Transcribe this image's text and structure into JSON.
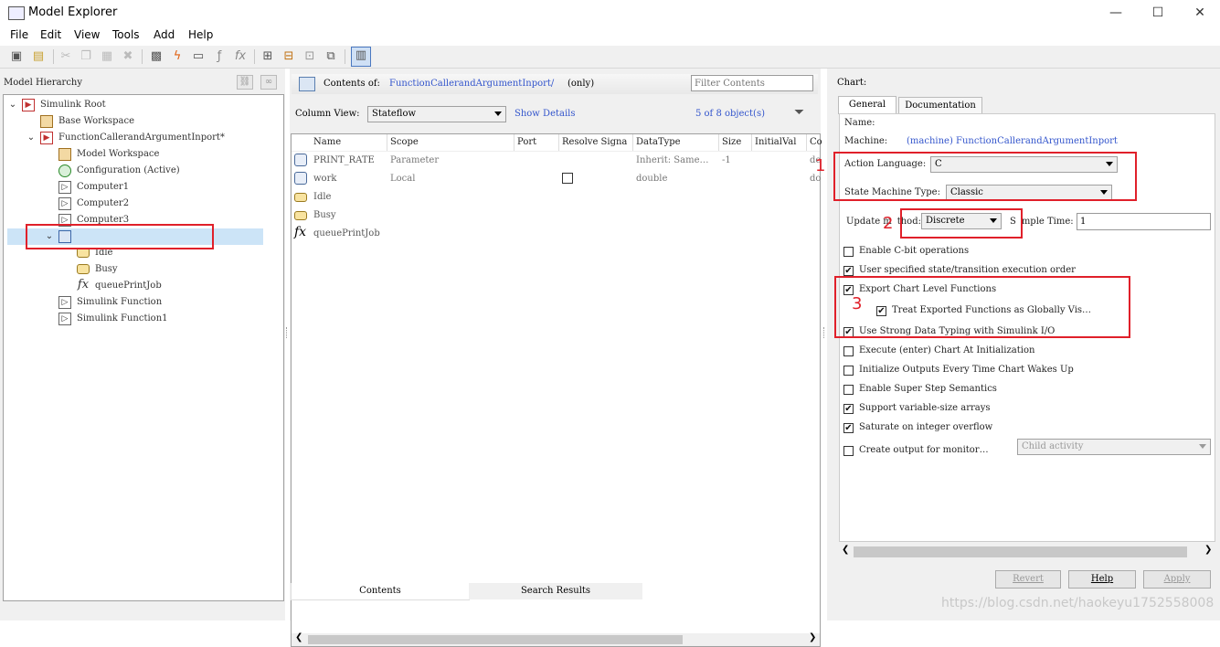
{
  "window": {
    "title": "Model Explorer",
    "min": "—",
    "max": "☐",
    "close": "✕"
  },
  "menu": [
    "File",
    "Edit",
    "View",
    "Tools",
    "Add",
    "Help"
  ],
  "left": {
    "header": "Model Hierarchy",
    "tree": [
      {
        "label": "Simulink Root",
        "indent": 0,
        "expander": "⌄",
        "icon": "simulink-root-icon"
      },
      {
        "label": "Base Workspace",
        "indent": 1,
        "expander": "",
        "icon": "workspace-icon"
      },
      {
        "label": "FunctionCallerandArgumentInport*",
        "indent": 1,
        "expander": "⌄",
        "icon": "model-icon"
      },
      {
        "label": "Model Workspace",
        "indent": 2,
        "expander": "",
        "icon": "workspace-icon"
      },
      {
        "label": "Configuration (Active)",
        "indent": 2,
        "expander": "",
        "icon": "config-gear-icon"
      },
      {
        "label": "Computer1",
        "indent": 2,
        "expander": "",
        "icon": "subsystem-icon"
      },
      {
        "label": "Computer2",
        "indent": 2,
        "expander": "",
        "icon": "subsystem-icon"
      },
      {
        "label": "Computer3",
        "indent": 2,
        "expander": "",
        "icon": "subsystem-icon"
      },
      {
        "label": "",
        "indent": 2,
        "expander": "⌄",
        "icon": "chart-icon",
        "selected": true
      },
      {
        "label": "Idle",
        "indent": 3,
        "expander": "",
        "icon": "state-icon"
      },
      {
        "label": "Busy",
        "indent": 3,
        "expander": "",
        "icon": "state-icon"
      },
      {
        "label": "queuePrintJob",
        "indent": 3,
        "expander": "",
        "icon": "function-icon"
      },
      {
        "label": "Simulink Function",
        "indent": 2,
        "expander": "",
        "icon": "subsystem-icon"
      },
      {
        "label": "Simulink Function1",
        "indent": 2,
        "expander": "",
        "icon": "subsystem-icon"
      }
    ]
  },
  "middle": {
    "contents_of": "Contents of:",
    "path": "FunctionCallerandArgumentInport/",
    "only": "(only)",
    "filter_placeholder": "Filter Contents",
    "column_view_label": "Column View:",
    "column_view_value": "Stateflow",
    "show_details": "Show Details",
    "count": "5 of 8 object(s)",
    "columns": [
      "Name",
      "Scope",
      "Port",
      "Resolve Signa",
      "DataType",
      "Size",
      "InitialVal",
      "Co"
    ],
    "rows": [
      {
        "name": "PRINT_RATE",
        "scope": "Parameter",
        "port": "",
        "resolve": "",
        "datatype": "Inherit: Same…",
        "size": "-1",
        "init": "",
        "co": "de",
        "icon": "data-icon"
      },
      {
        "name": "work",
        "scope": "Local",
        "port": "",
        "resolve": "checkbox",
        "datatype": "double",
        "size": "",
        "init": "",
        "co": "do",
        "icon": "data-icon"
      },
      {
        "name": "Idle",
        "scope": "",
        "port": "",
        "resolve": "",
        "datatype": "",
        "size": "",
        "init": "",
        "co": "",
        "icon": "state-icon"
      },
      {
        "name": "Busy",
        "scope": "",
        "port": "",
        "resolve": "",
        "datatype": "",
        "size": "",
        "init": "",
        "co": "",
        "icon": "state-icon"
      },
      {
        "name": "queuePrintJob",
        "scope": "",
        "port": "",
        "resolve": "",
        "datatype": "",
        "size": "",
        "init": "",
        "co": "",
        "icon": "function-icon"
      }
    ],
    "bottom_tabs": [
      "Contents",
      "Search Results"
    ]
  },
  "right": {
    "header": "Chart:",
    "tabs": [
      "General",
      "Documentation"
    ],
    "name_label": "Name:",
    "machine_label": "Machine:",
    "machine_value": "(machine) FunctionCallerandArgumentInport",
    "action_language_label": "Action Language:",
    "action_language_value": "C",
    "state_machine_label": "State Machine Type:",
    "state_machine_value": "Classic",
    "update_label_a": "Update m",
    "update_label_b": "thod:",
    "update_value": "Discrete",
    "sample_label_a": "S",
    "sample_label_b": "mple Time:",
    "sample_value": "1",
    "annot": [
      "1",
      "2",
      "3"
    ],
    "options": [
      {
        "label": "Enable C-bit operations",
        "checked": false
      },
      {
        "label": "User specified state/transition execution order",
        "checked": true
      },
      {
        "label": "Export Chart Level Functions",
        "checked": true
      },
      {
        "label": "Treat Exported Functions as Globally Vis…",
        "checked": true
      },
      {
        "label": "Use Strong Data Typing with Simulink I/O",
        "checked": true
      },
      {
        "label": "Execute (enter) Chart At Initialization",
        "checked": false
      },
      {
        "label": "Initialize Outputs Every Time Chart Wakes Up",
        "checked": false
      },
      {
        "label": "Enable Super Step Semantics",
        "checked": false
      },
      {
        "label": "Support variable-size arrays",
        "checked": true
      },
      {
        "label": "Saturate on integer overflow",
        "checked": true
      },
      {
        "label": "Create output for monitor…",
        "checked": false
      }
    ],
    "monitor_value": "Child activity",
    "buttons": [
      "Revert",
      "Help",
      "Apply"
    ]
  },
  "watermark": "https://blog.csdn.net/haokeyu1752558008"
}
